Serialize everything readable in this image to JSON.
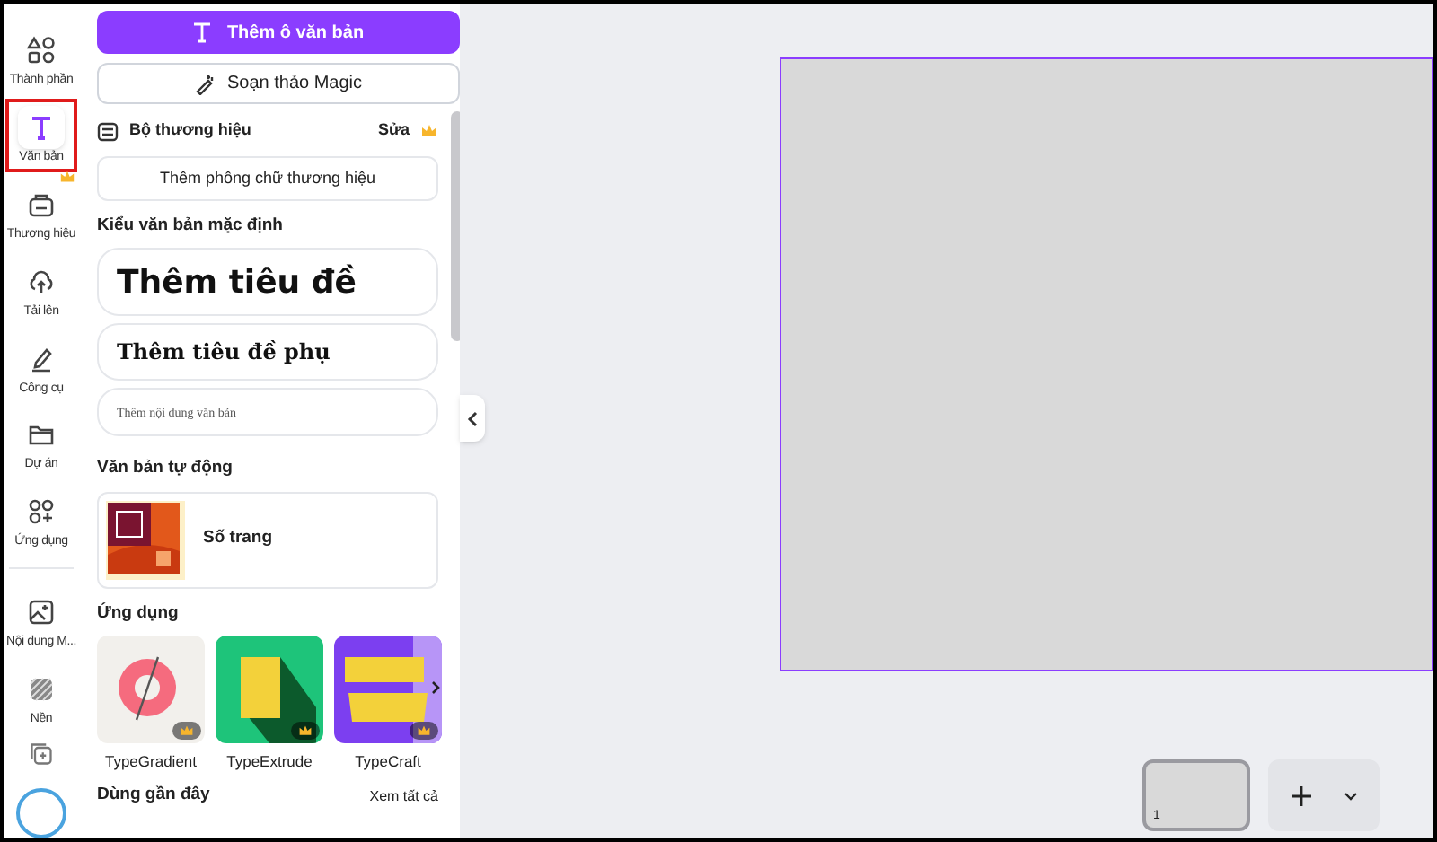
{
  "rail": {
    "items": [
      {
        "label": "Thành phần",
        "selected": false,
        "premium": false
      },
      {
        "label": "Văn bản",
        "selected": true,
        "premium": false
      },
      {
        "label": "Thương hiệu",
        "selected": false,
        "premium": true
      },
      {
        "label": "Tải lên",
        "selected": false,
        "premium": false
      },
      {
        "label": "Công cụ",
        "selected": false,
        "premium": false
      },
      {
        "label": "Dự án",
        "selected": false,
        "premium": false
      },
      {
        "label": "Ứng dụng",
        "selected": false,
        "premium": false
      },
      {
        "label": "Nội dung M...",
        "selected": false,
        "premium": false
      },
      {
        "label": "Nền",
        "selected": false,
        "premium": false
      }
    ]
  },
  "panel": {
    "add_textbox_button": "Thêm ô văn bản",
    "magic_write_button": "Soạn thảo Magic",
    "brand_kit": {
      "title": "Bộ thương hiệu",
      "edit_link": "Sửa",
      "add_font_button": "Thêm phông chữ thương hiệu"
    },
    "default_styles": {
      "title": "Kiểu văn bản mặc định",
      "items": [
        {
          "kind": "heading",
          "label": "Thêm tiêu đề"
        },
        {
          "kind": "subheading",
          "label": "Thêm tiêu đề phụ"
        },
        {
          "kind": "body",
          "label": "Thêm nội dung văn bản"
        }
      ]
    },
    "dynamic_text": {
      "title": "Văn bản tự động",
      "items": [
        {
          "label": "Số trang"
        }
      ]
    },
    "apps": {
      "title": "Ứng dụng",
      "items": [
        {
          "label": "TypeGradient",
          "premium": true
        },
        {
          "label": "TypeExtrude",
          "premium": true
        },
        {
          "label": "TypeCraft",
          "premium": true
        }
      ]
    },
    "recent": {
      "title": "Dùng gần đây",
      "see_all_link": "Xem tất cả"
    }
  },
  "pages": [
    {
      "number": "1",
      "selected": true
    }
  ]
}
